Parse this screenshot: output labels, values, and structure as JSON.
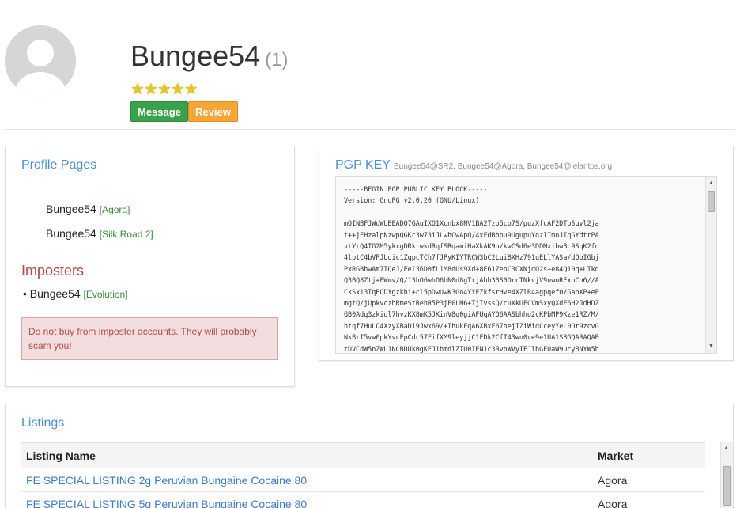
{
  "profile": {
    "name": "Bungee54",
    "review_count": "(1)",
    "stars": "★★★★★",
    "message_label": "Message",
    "review_label": "Review"
  },
  "profile_pages": {
    "title": "Profile Pages",
    "items": [
      {
        "name": "Bungee54",
        "market": "[Agora]"
      },
      {
        "name": "Bungee54",
        "market": "[Silk Road 2]"
      }
    ]
  },
  "imposters": {
    "title": "Imposters",
    "items": [
      {
        "name": "Bungee54",
        "market": "[Evolution]"
      }
    ],
    "warning": "Do not buy from imposter accounts. They will probably scam you!"
  },
  "pgp": {
    "title": "PGP KEY",
    "identities": "Bungee54@SR2, Bungee54@Agora, Bungee54@lelantos.org",
    "key_text": "-----BEGIN PGP PUBLIC KEY BLOCK-----\nVersion: GnuPG v2.0.20 (GNU/Linux)\n\nmQINBFJWuWUBEADO7GAuIXO1Xcnbx8NV1BA2Tzo5co7S/puzXfcAF2DTbSuvl2ja\nt++jEHzalpNzwpQGKc3w73iJLwhCwApQ/4xFdBhpu9UgupuYozIImoJIqGYdtrPA\nvtYrQ4TG2M5ykxgDRkrwkdRqfSRqamiHaXkAK9o/kwCSd6e3DDMxibwBc9SqK2fo\n4lptC4bVPJUoic1ZqpcTCh7fJPyKIYTRCW3bC2LuiBXHz791uELlYASa/dQbIGbj\nPxRGBhwAm7TQeJ/Eel36D0fL1M8dUs9Xd+8E61ZebC3CXNjdQ2s+e84Q10q+LTkd\nQ3BQ8Ztj+FWmv/Q/13hO6whO6bN0d8gTrjAhh33S0DrcTNkvjV9uwnRExoCo6//A\nCkSx13TqBCDYgzkbi+cl5pDwUwK3Go4YYFZkfsrHve4XZlR4agpqef0/GapXP+eP\nmgtQ/jUpkvczhRmeStRehR5P3jF0LM6+TjTvssQ/cuXkUFCVmSxyQXdF6H2JdHDZ\nGB0Adq3zkiol7hvzKX8mK5JKinV8q0giAFUqAYO6AASbhho2cKPbMP9Kze1RZ/M/\nhtqf7HuLO4XzyXBaDi9Jwx69/+IhukFqA6XBxF67hejIZiWidCceyYeL0Or9zcvG\nNkBrI5vw0pkYvcEpCdc57FifXM9leyjjC1FDk2CfT43wn0ve9e1UA1S8GQARAQAB\ntDVCdW5nZWU1NCBDUk0gKEJ1bmdlZTU0IEN1c3RvbWVyIFJlbGF0aW9ucyBNYW5h"
  },
  "listings": {
    "title": "Listings",
    "columns": [
      "Listing Name",
      "Market"
    ],
    "rows": [
      {
        "name": "FE SPECIAL LISTING 2g Peruvian Bungaine Cocaine 80",
        "market": "Agora"
      },
      {
        "name": "FE SPECIAL LISTING 5g Peruvian Bungaine Cocaine 80",
        "market": "Agora"
      }
    ]
  }
}
